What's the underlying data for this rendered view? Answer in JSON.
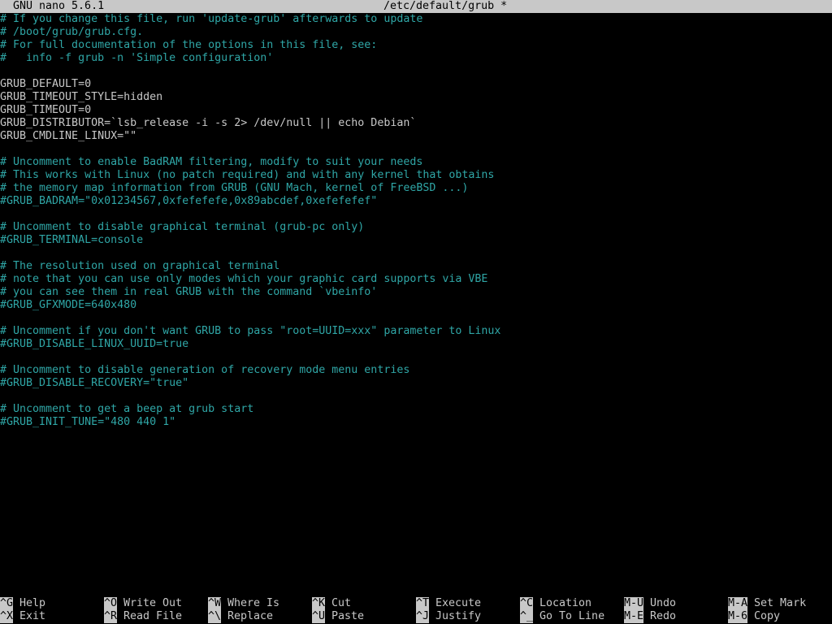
{
  "titlebar": {
    "app": "GNU nano 5.6.1",
    "file": "/etc/default/grub *"
  },
  "lines": [
    {
      "text": "# If you change this file, run 'update-grub' afterwards to update",
      "kind": "comment"
    },
    {
      "text": "# /boot/grub/grub.cfg.",
      "kind": "comment"
    },
    {
      "text": "# For full documentation of the options in this file, see:",
      "kind": "comment"
    },
    {
      "text": "#   info -f grub -n 'Simple configuration'",
      "kind": "comment"
    },
    {
      "text": "",
      "kind": "blank"
    },
    {
      "text": "GRUB_DEFAULT=0",
      "kind": "setting"
    },
    {
      "text": "GRUB_TIMEOUT_STYLE=hidden",
      "kind": "setting"
    },
    {
      "text": "GRUB_TIMEOUT=0",
      "kind": "setting"
    },
    {
      "text": "GRUB_DISTRIBUTOR=`lsb_release -i -s 2> /dev/null || echo Debian`",
      "kind": "setting"
    },
    {
      "text": "GRUB_CMDLINE_LINUX=\"\"",
      "kind": "setting"
    },
    {
      "text": "",
      "kind": "blank"
    },
    {
      "text": "# Uncomment to enable BadRAM filtering, modify to suit your needs",
      "kind": "comment"
    },
    {
      "text": "# This works with Linux (no patch required) and with any kernel that obtains",
      "kind": "comment"
    },
    {
      "text": "# the memory map information from GRUB (GNU Mach, kernel of FreeBSD ...)",
      "kind": "comment"
    },
    {
      "text": "#GRUB_BADRAM=\"0x01234567,0xfefefefe,0x89abcdef,0xefefefef\"",
      "kind": "comment"
    },
    {
      "text": "",
      "kind": "blank"
    },
    {
      "text": "# Uncomment to disable graphical terminal (grub-pc only)",
      "kind": "comment"
    },
    {
      "text": "#GRUB_TERMINAL=console",
      "kind": "comment"
    },
    {
      "text": "",
      "kind": "blank"
    },
    {
      "text": "# The resolution used on graphical terminal",
      "kind": "comment"
    },
    {
      "text": "# note that you can use only modes which your graphic card supports via VBE",
      "kind": "comment"
    },
    {
      "text": "# you can see them in real GRUB with the command `vbeinfo'",
      "kind": "comment"
    },
    {
      "text": "#GRUB_GFXMODE=640x480",
      "kind": "comment"
    },
    {
      "text": "",
      "kind": "blank"
    },
    {
      "text": "# Uncomment if you don't want GRUB to pass \"root=UUID=xxx\" parameter to Linux",
      "kind": "comment"
    },
    {
      "text": "#GRUB_DISABLE_LINUX_UUID=true",
      "kind": "comment"
    },
    {
      "text": "",
      "kind": "blank"
    },
    {
      "text": "# Uncomment to disable generation of recovery mode menu entries",
      "kind": "comment"
    },
    {
      "text": "#GRUB_DISABLE_RECOVERY=\"true\"",
      "kind": "comment"
    },
    {
      "text": "",
      "kind": "blank"
    },
    {
      "text": "# Uncomment to get a beep at grub start",
      "kind": "comment"
    },
    {
      "text": "#GRUB_INIT_TUNE=\"480 440 1\"",
      "kind": "comment"
    }
  ],
  "shortcuts": [
    {
      "key": "^G",
      "label": "Help"
    },
    {
      "key": "^X",
      "label": "Exit"
    },
    {
      "key": "^O",
      "label": "Write Out"
    },
    {
      "key": "^R",
      "label": "Read File"
    },
    {
      "key": "^W",
      "label": "Where Is"
    },
    {
      "key": "^\\",
      "label": "Replace"
    },
    {
      "key": "^K",
      "label": "Cut"
    },
    {
      "key": "^U",
      "label": "Paste"
    },
    {
      "key": "^T",
      "label": "Execute"
    },
    {
      "key": "^J",
      "label": "Justify"
    },
    {
      "key": "^C",
      "label": "Location"
    },
    {
      "key": "^_",
      "label": "Go To Line"
    },
    {
      "key": "M-U",
      "label": "Undo"
    },
    {
      "key": "M-E",
      "label": "Redo"
    },
    {
      "key": "M-A",
      "label": "Set Mark"
    },
    {
      "key": "M-6",
      "label": "Copy"
    }
  ],
  "colors": {
    "comment": "#2fa6a6",
    "text": "#c8c8c8",
    "background": "#000000",
    "bar": "#c8c8c8"
  }
}
